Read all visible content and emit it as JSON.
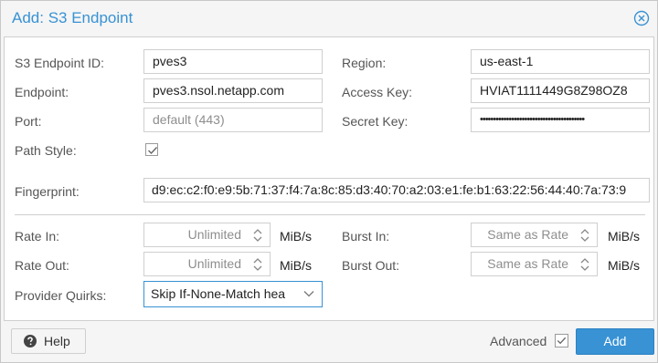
{
  "dialog": {
    "title": "Add: S3 Endpoint",
    "accent_color": "#3892d4"
  },
  "form": {
    "endpoint_id": {
      "label": "S3 Endpoint ID:",
      "value": "pves3"
    },
    "region": {
      "label": "Region:",
      "value": "us-east-1"
    },
    "endpoint": {
      "label": "Endpoint:",
      "value": "pves3.nsol.netapp.com"
    },
    "access_key": {
      "label": "Access Key:",
      "value": "HVIAT1111449G8Z98OZ8"
    },
    "port": {
      "label": "Port:",
      "placeholder": "default (443)"
    },
    "secret_key": {
      "label": "Secret Key:",
      "value": "••••••••••••••••••••••••••••••••••••••••"
    },
    "path_style": {
      "label": "Path Style:",
      "checked": true
    },
    "fingerprint": {
      "label": "Fingerprint:",
      "value": "d9:ec:c2:f0:e9:5b:71:37:f4:7a:8c:85:d3:40:70:a2:03:e1:fe:b1:63:22:56:44:40:7a:73:9"
    },
    "rate_in": {
      "label": "Rate In:",
      "value": "Unlimited",
      "unit": "MiB/s"
    },
    "burst_in": {
      "label": "Burst In:",
      "value": "Same as Rate",
      "unit": "MiB/s"
    },
    "rate_out": {
      "label": "Rate Out:",
      "value": "Unlimited",
      "unit": "MiB/s"
    },
    "burst_out": {
      "label": "Burst Out:",
      "value": "Same as Rate",
      "unit": "MiB/s"
    },
    "provider_quirks": {
      "label": "Provider Quirks:",
      "value": "Skip If-None-Match hea"
    }
  },
  "footer": {
    "help_label": "Help",
    "advanced_label": "Advanced",
    "advanced_checked": true,
    "add_label": "Add"
  },
  "icons": {
    "close": "close-circle-icon",
    "help": "question-circle-icon",
    "spinner": "spinner-arrows-icon",
    "dropdown": "chevron-down-icon",
    "check": "checkmark-icon"
  }
}
